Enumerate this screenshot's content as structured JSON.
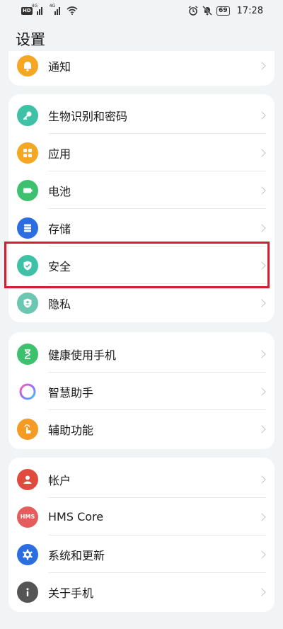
{
  "status_bar": {
    "hd_badge": "HD",
    "network_1": "4G",
    "network_2": "4G",
    "battery": "69",
    "time": "17:28"
  },
  "header": {
    "title": "设置"
  },
  "groups": [
    {
      "items": [
        {
          "label": "通知",
          "icon": "bell-icon",
          "color": "#f5a623"
        }
      ]
    },
    {
      "items": [
        {
          "label": "生物识别和密码",
          "icon": "key-icon",
          "color": "#3fc1a8"
        },
        {
          "label": "应用",
          "icon": "apps-grid-icon",
          "color": "#f5a623"
        },
        {
          "label": "电池",
          "icon": "battery-icon",
          "color": "#3ec16f"
        },
        {
          "label": "存储",
          "icon": "storage-icon",
          "color": "#2a6ee0"
        },
        {
          "label": "安全",
          "icon": "shield-check-icon",
          "color": "#3fc1a8"
        },
        {
          "label": "隐私",
          "icon": "privacy-shield-icon",
          "color": "#6cc7b2"
        }
      ]
    },
    {
      "items": [
        {
          "label": "健康使用手机",
          "icon": "hourglass-icon",
          "color": "#3ec16f"
        },
        {
          "label": "智慧助手",
          "icon": "assistant-ring-icon",
          "color": "#ffffff"
        },
        {
          "label": "辅助功能",
          "icon": "hand-tap-icon",
          "color": "#f59a23"
        }
      ]
    },
    {
      "items": [
        {
          "label": "帐户",
          "icon": "user-icon",
          "color": "#e04a3f"
        },
        {
          "label": "HMS Core",
          "icon": "hms-icon",
          "color": "#e35d5d",
          "icon_text": "HMS"
        },
        {
          "label": "系统和更新",
          "icon": "gear-icon",
          "color": "#2a6ee0"
        },
        {
          "label": "关于手机",
          "icon": "info-icon",
          "color": "#555555"
        }
      ]
    }
  ],
  "highlight_color": "#d0202f"
}
